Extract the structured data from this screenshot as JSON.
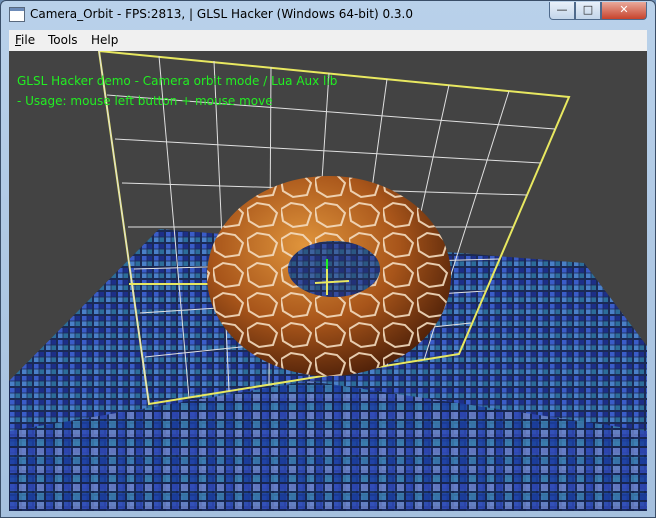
{
  "window": {
    "title": "Camera_Orbit - FPS:2813,  | GLSL Hacker (Windows 64-bit) 0.3.0",
    "controls": {
      "minimize": "—",
      "maximize": "□",
      "close": "✕"
    }
  },
  "menu": [
    {
      "label": "File",
      "underline": "F",
      "rest": "ile"
    },
    {
      "label": "Tools",
      "underline": "",
      "rest": "Tools"
    },
    {
      "label": "Help",
      "underline": "",
      "rest": "Help"
    }
  ],
  "overlay": {
    "line1": "GLSL Hacker demo - Camera orbit mode / Lua Aux lib",
    "line2": "- Usage: mouse left button + mouse move"
  },
  "colors": {
    "overlay_text": "#22ee22",
    "viewport_bg": "#434343",
    "grid_frame": "#e8e860",
    "grid_lines": "#e0e0e0",
    "torus": "#b8651a",
    "torus_cells": "#f3dcc0"
  },
  "icons": {
    "app": "window-app-icon",
    "minimize": "minimize-icon",
    "maximize": "maximize-icon",
    "close": "close-icon"
  }
}
